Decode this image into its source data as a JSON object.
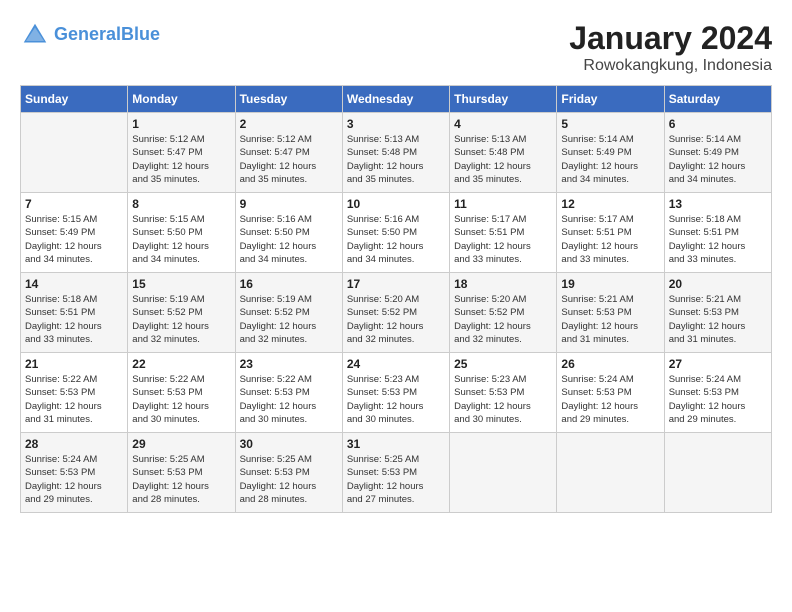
{
  "header": {
    "logo_line1": "General",
    "logo_line2": "Blue",
    "month": "January 2024",
    "location": "Rowokangkung, Indonesia"
  },
  "weekdays": [
    "Sunday",
    "Monday",
    "Tuesday",
    "Wednesday",
    "Thursday",
    "Friday",
    "Saturday"
  ],
  "weeks": [
    [
      {
        "day": "",
        "info": ""
      },
      {
        "day": "1",
        "info": "Sunrise: 5:12 AM\nSunset: 5:47 PM\nDaylight: 12 hours\nand 35 minutes."
      },
      {
        "day": "2",
        "info": "Sunrise: 5:12 AM\nSunset: 5:47 PM\nDaylight: 12 hours\nand 35 minutes."
      },
      {
        "day": "3",
        "info": "Sunrise: 5:13 AM\nSunset: 5:48 PM\nDaylight: 12 hours\nand 35 minutes."
      },
      {
        "day": "4",
        "info": "Sunrise: 5:13 AM\nSunset: 5:48 PM\nDaylight: 12 hours\nand 35 minutes."
      },
      {
        "day": "5",
        "info": "Sunrise: 5:14 AM\nSunset: 5:49 PM\nDaylight: 12 hours\nand 34 minutes."
      },
      {
        "day": "6",
        "info": "Sunrise: 5:14 AM\nSunset: 5:49 PM\nDaylight: 12 hours\nand 34 minutes."
      }
    ],
    [
      {
        "day": "7",
        "info": "Sunrise: 5:15 AM\nSunset: 5:49 PM\nDaylight: 12 hours\nand 34 minutes."
      },
      {
        "day": "8",
        "info": "Sunrise: 5:15 AM\nSunset: 5:50 PM\nDaylight: 12 hours\nand 34 minutes."
      },
      {
        "day": "9",
        "info": "Sunrise: 5:16 AM\nSunset: 5:50 PM\nDaylight: 12 hours\nand 34 minutes."
      },
      {
        "day": "10",
        "info": "Sunrise: 5:16 AM\nSunset: 5:50 PM\nDaylight: 12 hours\nand 34 minutes."
      },
      {
        "day": "11",
        "info": "Sunrise: 5:17 AM\nSunset: 5:51 PM\nDaylight: 12 hours\nand 33 minutes."
      },
      {
        "day": "12",
        "info": "Sunrise: 5:17 AM\nSunset: 5:51 PM\nDaylight: 12 hours\nand 33 minutes."
      },
      {
        "day": "13",
        "info": "Sunrise: 5:18 AM\nSunset: 5:51 PM\nDaylight: 12 hours\nand 33 minutes."
      }
    ],
    [
      {
        "day": "14",
        "info": "Sunrise: 5:18 AM\nSunset: 5:51 PM\nDaylight: 12 hours\nand 33 minutes."
      },
      {
        "day": "15",
        "info": "Sunrise: 5:19 AM\nSunset: 5:52 PM\nDaylight: 12 hours\nand 32 minutes."
      },
      {
        "day": "16",
        "info": "Sunrise: 5:19 AM\nSunset: 5:52 PM\nDaylight: 12 hours\nand 32 minutes."
      },
      {
        "day": "17",
        "info": "Sunrise: 5:20 AM\nSunset: 5:52 PM\nDaylight: 12 hours\nand 32 minutes."
      },
      {
        "day": "18",
        "info": "Sunrise: 5:20 AM\nSunset: 5:52 PM\nDaylight: 12 hours\nand 32 minutes."
      },
      {
        "day": "19",
        "info": "Sunrise: 5:21 AM\nSunset: 5:53 PM\nDaylight: 12 hours\nand 31 minutes."
      },
      {
        "day": "20",
        "info": "Sunrise: 5:21 AM\nSunset: 5:53 PM\nDaylight: 12 hours\nand 31 minutes."
      }
    ],
    [
      {
        "day": "21",
        "info": "Sunrise: 5:22 AM\nSunset: 5:53 PM\nDaylight: 12 hours\nand 31 minutes."
      },
      {
        "day": "22",
        "info": "Sunrise: 5:22 AM\nSunset: 5:53 PM\nDaylight: 12 hours\nand 30 minutes."
      },
      {
        "day": "23",
        "info": "Sunrise: 5:22 AM\nSunset: 5:53 PM\nDaylight: 12 hours\nand 30 minutes."
      },
      {
        "day": "24",
        "info": "Sunrise: 5:23 AM\nSunset: 5:53 PM\nDaylight: 12 hours\nand 30 minutes."
      },
      {
        "day": "25",
        "info": "Sunrise: 5:23 AM\nSunset: 5:53 PM\nDaylight: 12 hours\nand 30 minutes."
      },
      {
        "day": "26",
        "info": "Sunrise: 5:24 AM\nSunset: 5:53 PM\nDaylight: 12 hours\nand 29 minutes."
      },
      {
        "day": "27",
        "info": "Sunrise: 5:24 AM\nSunset: 5:53 PM\nDaylight: 12 hours\nand 29 minutes."
      }
    ],
    [
      {
        "day": "28",
        "info": "Sunrise: 5:24 AM\nSunset: 5:53 PM\nDaylight: 12 hours\nand 29 minutes."
      },
      {
        "day": "29",
        "info": "Sunrise: 5:25 AM\nSunset: 5:53 PM\nDaylight: 12 hours\nand 28 minutes."
      },
      {
        "day": "30",
        "info": "Sunrise: 5:25 AM\nSunset: 5:53 PM\nDaylight: 12 hours\nand 28 minutes."
      },
      {
        "day": "31",
        "info": "Sunrise: 5:25 AM\nSunset: 5:53 PM\nDaylight: 12 hours\nand 27 minutes."
      },
      {
        "day": "",
        "info": ""
      },
      {
        "day": "",
        "info": ""
      },
      {
        "day": "",
        "info": ""
      }
    ]
  ]
}
